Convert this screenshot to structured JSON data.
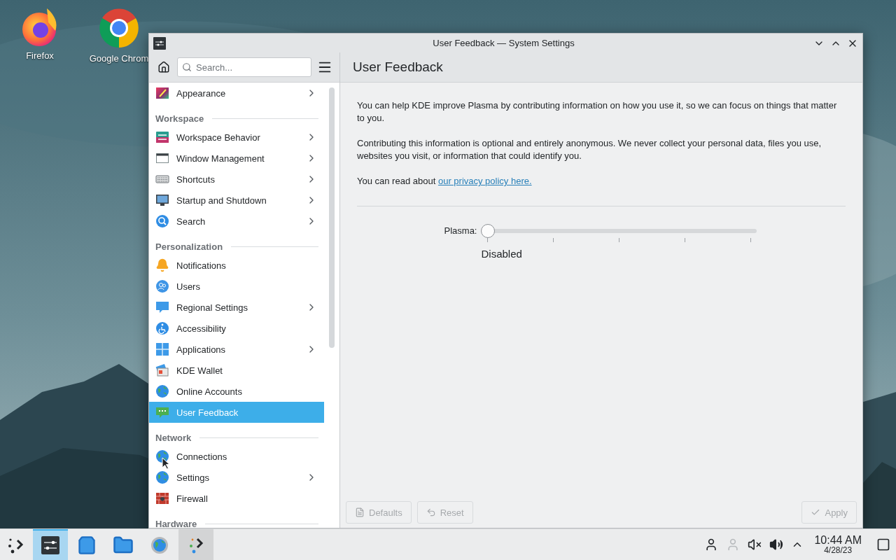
{
  "desktop_icons": [
    {
      "label": "Firefox"
    },
    {
      "label": "Google Chrom"
    }
  ],
  "window": {
    "title": "User Feedback — System Settings",
    "search": {
      "placeholder": "Search..."
    },
    "sidebar": {
      "sections": [
        {
          "items": [
            {
              "label": "Appearance",
              "has_submenu": true,
              "selected": false
            }
          ]
        },
        {
          "title": "Workspace",
          "items": [
            {
              "label": "Workspace Behavior",
              "has_submenu": true,
              "selected": false
            },
            {
              "label": "Window Management",
              "has_submenu": true,
              "selected": false
            },
            {
              "label": "Shortcuts",
              "has_submenu": true,
              "selected": false
            },
            {
              "label": "Startup and Shutdown",
              "has_submenu": true,
              "selected": false
            },
            {
              "label": "Search",
              "has_submenu": true,
              "selected": false
            }
          ]
        },
        {
          "title": "Personalization",
          "items": [
            {
              "label": "Notifications",
              "has_submenu": false,
              "selected": false
            },
            {
              "label": "Users",
              "has_submenu": false,
              "selected": false
            },
            {
              "label": "Regional Settings",
              "has_submenu": true,
              "selected": false
            },
            {
              "label": "Accessibility",
              "has_submenu": false,
              "selected": false
            },
            {
              "label": "Applications",
              "has_submenu": true,
              "selected": false
            },
            {
              "label": "KDE Wallet",
              "has_submenu": false,
              "selected": false
            },
            {
              "label": "Online Accounts",
              "has_submenu": false,
              "selected": false
            },
            {
              "label": "User Feedback",
              "has_submenu": false,
              "selected": true
            }
          ]
        },
        {
          "title": "Network",
          "items": [
            {
              "label": "Connections",
              "has_submenu": false,
              "selected": false
            },
            {
              "label": "Settings",
              "has_submenu": true,
              "selected": false
            },
            {
              "label": "Firewall",
              "has_submenu": false,
              "selected": false
            }
          ]
        },
        {
          "title": "Hardware"
        }
      ]
    },
    "page_title": "User Feedback",
    "paragraphs": [
      {
        "text": "You can help KDE improve Plasma by contributing information on how you use it, so we can focus on things that matter to you."
      },
      {
        "text": "Contributing this information is optional and entirely anonymous. We never collect your personal data, files you use, websites you visit, or information that could identify you."
      },
      {
        "text": "You can read about",
        "link": "our privacy policy here."
      }
    ],
    "slider": {
      "label": "Plasma:",
      "level": 0,
      "value_label": "Disabled"
    },
    "buttons": [
      {
        "kind": "defaults",
        "label": "Defaults",
        "disabled": true
      },
      {
        "kind": "reset",
        "label": "Reset",
        "disabled": true
      },
      {
        "kind": "apply",
        "label": "Apply",
        "disabled": true
      }
    ]
  },
  "taskbar": {
    "apps": [
      {
        "selected": false,
        "hovered": false
      },
      {
        "selected": true,
        "hovered": false
      },
      {
        "selected": false,
        "hovered": false
      },
      {
        "selected": false,
        "hovered": false
      },
      {
        "selected": false,
        "hovered": false
      },
      {
        "selected": false,
        "hovered": true
      }
    ],
    "clock": {
      "time": "10:44 AM",
      "date": "4/28/23"
    }
  }
}
